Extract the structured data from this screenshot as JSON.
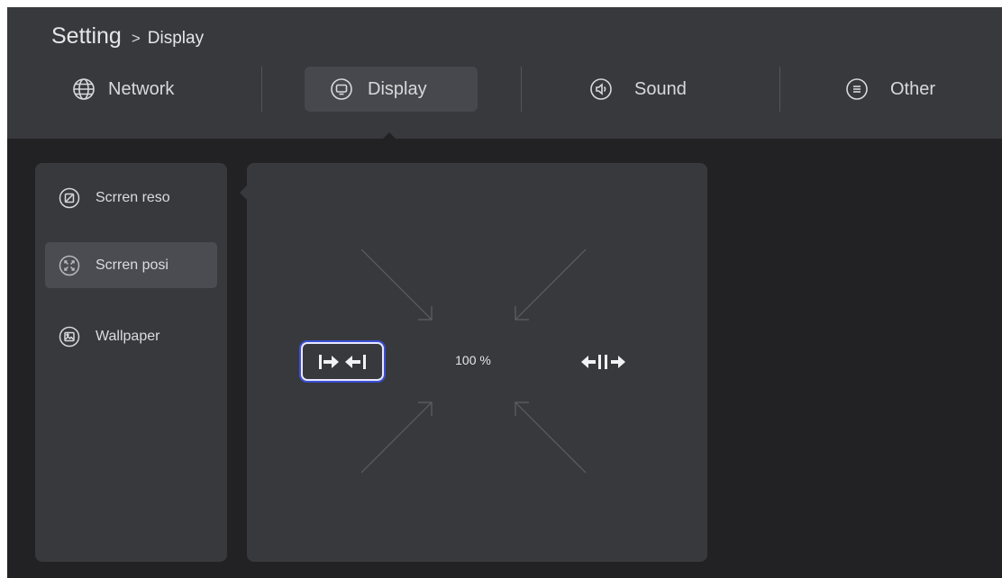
{
  "colors": {
    "accent": "#3a4fd6",
    "background": "#222225",
    "panel": "#38393d",
    "text": "#dcdcdf"
  },
  "breadcrumb": {
    "root": "Setting",
    "separator": ">",
    "current": "Display"
  },
  "tabs": [
    {
      "label": "Network",
      "icon": "globe-icon"
    },
    {
      "label": "Display",
      "icon": "monitor-icon",
      "selected": true
    },
    {
      "label": "Sound",
      "icon": "speaker-icon"
    },
    {
      "label": "Other",
      "icon": "menu-icon"
    }
  ],
  "side_menu": [
    {
      "label": "Scrren reso",
      "icon": "resolution-icon"
    },
    {
      "label": "Scrren posi",
      "icon": "position-icon",
      "selected": true
    },
    {
      "label": "Wallpaper",
      "icon": "wallpaper-icon"
    }
  ],
  "screen_position": {
    "zoom": "100 %",
    "shrink_icon": "shrink-icon",
    "expand_icon": "expand-icon"
  }
}
